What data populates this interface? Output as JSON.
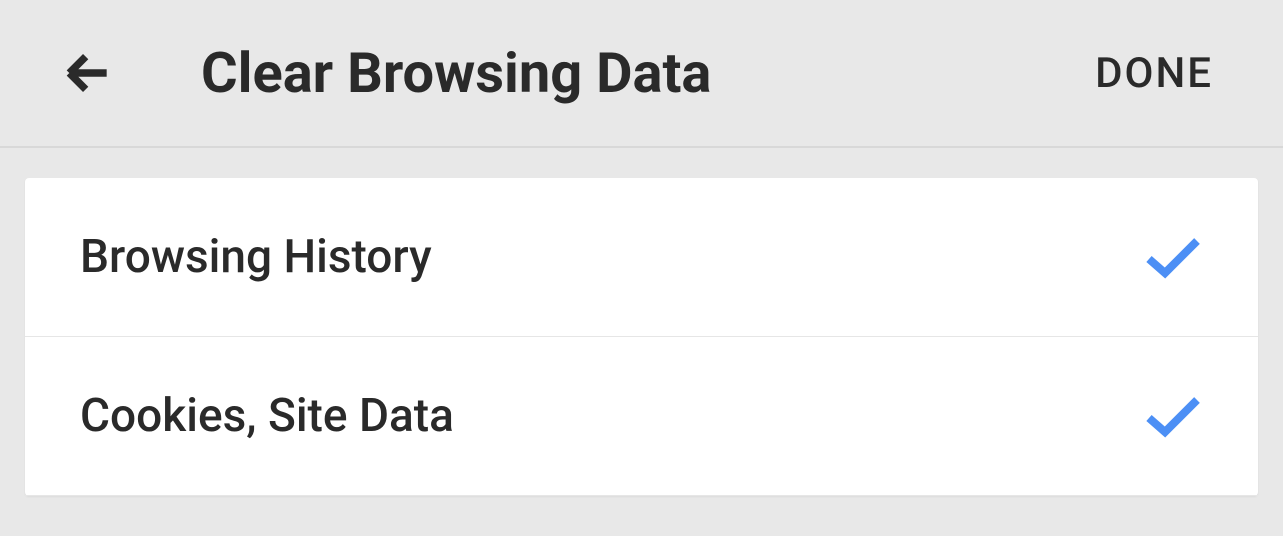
{
  "header": {
    "title": "Clear Browsing Data",
    "done_label": "DONE"
  },
  "items": [
    {
      "label": "Browsing History",
      "checked": true
    },
    {
      "label": "Cookies, Site Data",
      "checked": true
    }
  ],
  "colors": {
    "checkmark": "#4c8ff5"
  }
}
